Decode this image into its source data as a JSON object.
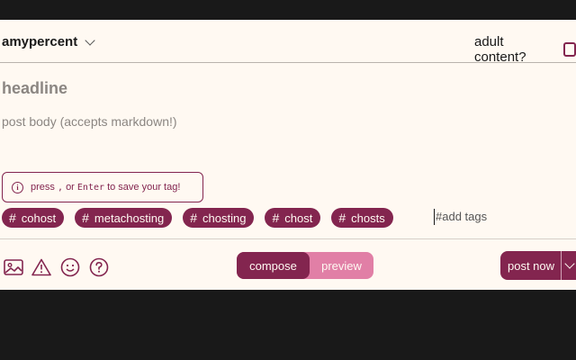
{
  "header": {
    "handle": "amypercent",
    "adult_label": "adult content?"
  },
  "editor": {
    "headline_placeholder": "headline",
    "body_placeholder": "post body (accepts markdown!)"
  },
  "hint": {
    "press": "press",
    "comma_key": ",",
    "or": "or",
    "enter_key": "Enter",
    "suffix": "to save your tag!"
  },
  "tags": [
    {
      "label": "cohost"
    },
    {
      "label": "metachosting"
    },
    {
      "label": "chosting"
    },
    {
      "label": "chost"
    },
    {
      "label": "chosts"
    }
  ],
  "tag_input": {
    "placeholder": "#add tags"
  },
  "toolbar": {
    "icons": [
      "image-icon",
      "content-warning-icon",
      "emoji-icon",
      "help-icon"
    ]
  },
  "mode_toggle": {
    "compose": "compose",
    "preview": "preview",
    "active": "compose"
  },
  "post_button": {
    "label": "post now"
  },
  "colors": {
    "accent": "#83254f",
    "accent_light": "#e17fa6",
    "background": "#fff9f2",
    "frame": "#191919"
  }
}
